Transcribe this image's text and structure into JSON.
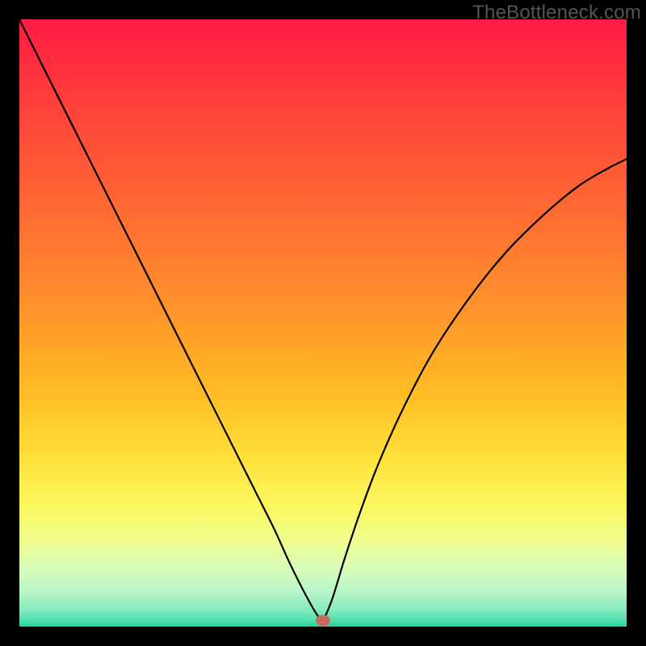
{
  "watermark": "TheBottleneck.com",
  "colors": {
    "gradient_stops": [
      {
        "offset": 0.0,
        "hex": "#ff1a44"
      },
      {
        "offset": 0.12,
        "hex": "#ff3b3d"
      },
      {
        "offset": 0.25,
        "hex": "#ff5a36"
      },
      {
        "offset": 0.38,
        "hex": "#ff7a2f"
      },
      {
        "offset": 0.5,
        "hex": "#ff9a29"
      },
      {
        "offset": 0.62,
        "hex": "#ffbd25"
      },
      {
        "offset": 0.72,
        "hex": "#ffe03a"
      },
      {
        "offset": 0.8,
        "hex": "#fbf75e"
      },
      {
        "offset": 0.86,
        "hex": "#effd8f"
      },
      {
        "offset": 0.9,
        "hex": "#dbfcb6"
      },
      {
        "offset": 0.94,
        "hex": "#baf6c8"
      },
      {
        "offset": 0.97,
        "hex": "#8becc0"
      },
      {
        "offset": 0.99,
        "hex": "#4fdfae"
      },
      {
        "offset": 1.0,
        "hex": "#21d39a"
      }
    ],
    "marker": "#c46d5e",
    "curve": "#000000",
    "frame": "#000000"
  },
  "chart_data": {
    "type": "line",
    "title": "",
    "xlabel": "",
    "ylabel": "",
    "xlim": [
      0,
      1
    ],
    "ylim": [
      0,
      1
    ],
    "marker": {
      "x": 0.5,
      "y": 0.01
    },
    "series": [
      {
        "name": "curve",
        "x": [
          0.0,
          0.03,
          0.06,
          0.09,
          0.12,
          0.15,
          0.18,
          0.21,
          0.24,
          0.27,
          0.3,
          0.33,
          0.36,
          0.39,
          0.42,
          0.445,
          0.47,
          0.49,
          0.5,
          0.515,
          0.535,
          0.56,
          0.59,
          0.63,
          0.68,
          0.74,
          0.8,
          0.86,
          0.92,
          0.97,
          1.0
        ],
        "y": [
          1.0,
          0.94,
          0.88,
          0.82,
          0.76,
          0.7,
          0.64,
          0.58,
          0.52,
          0.46,
          0.4,
          0.34,
          0.28,
          0.22,
          0.16,
          0.105,
          0.055,
          0.02,
          0.012,
          0.045,
          0.11,
          0.185,
          0.265,
          0.355,
          0.45,
          0.54,
          0.615,
          0.675,
          0.725,
          0.755,
          0.77
        ]
      }
    ]
  }
}
